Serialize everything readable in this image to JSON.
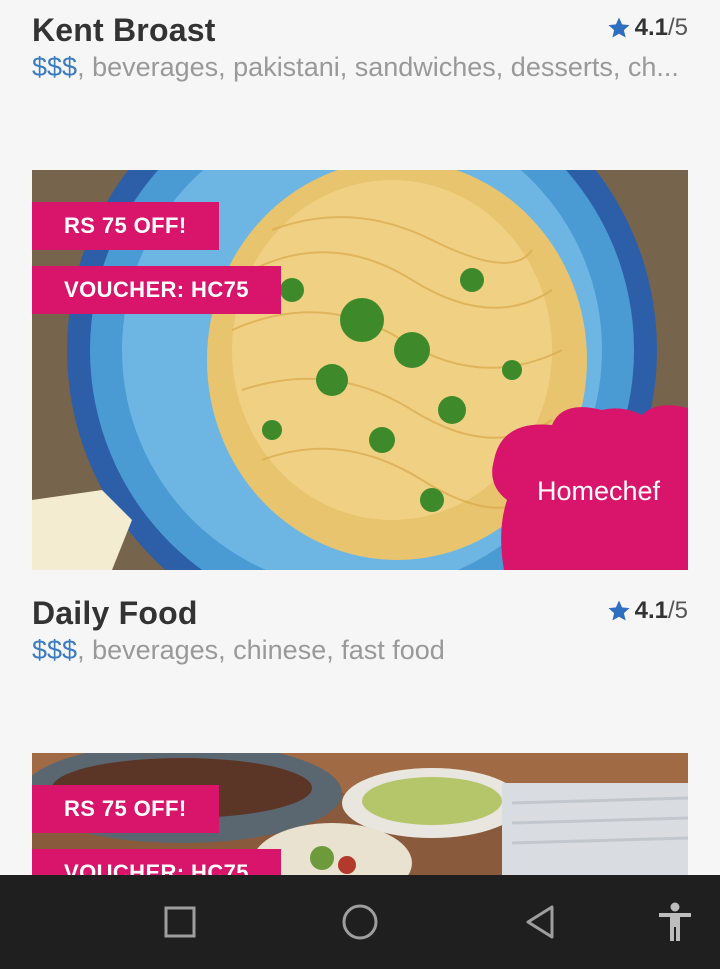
{
  "restaurants": [
    {
      "name": "Kent Broast",
      "price": "$$$",
      "tags": ", beverages, pakistani, sandwiches, desserts, ch...",
      "rating_score": "4.1",
      "rating_total": "/5"
    },
    {
      "name": "Daily Food",
      "price": "$$$",
      "tags": ", beverages, chinese, fast food",
      "rating_score": "4.1",
      "rating_total": "/5"
    }
  ],
  "cards": [
    {
      "discount_badge": "RS 75 OFF!",
      "voucher_badge": "VOUCHER: HC75",
      "brand_logo": "Homechef"
    },
    {
      "discount_badge": "RS 75 OFF!",
      "voucher_badge": "VOUCHER: HC75"
    }
  ],
  "navigation": {
    "icons": [
      "recent-apps-icon",
      "home-icon",
      "back-icon",
      "accessibility-icon"
    ]
  },
  "colors": {
    "brand_pink": "#d9156b",
    "star_blue": "#2f6fbf",
    "price_blue": "#3b7bbf",
    "navbar": "#1f1f1f"
  }
}
